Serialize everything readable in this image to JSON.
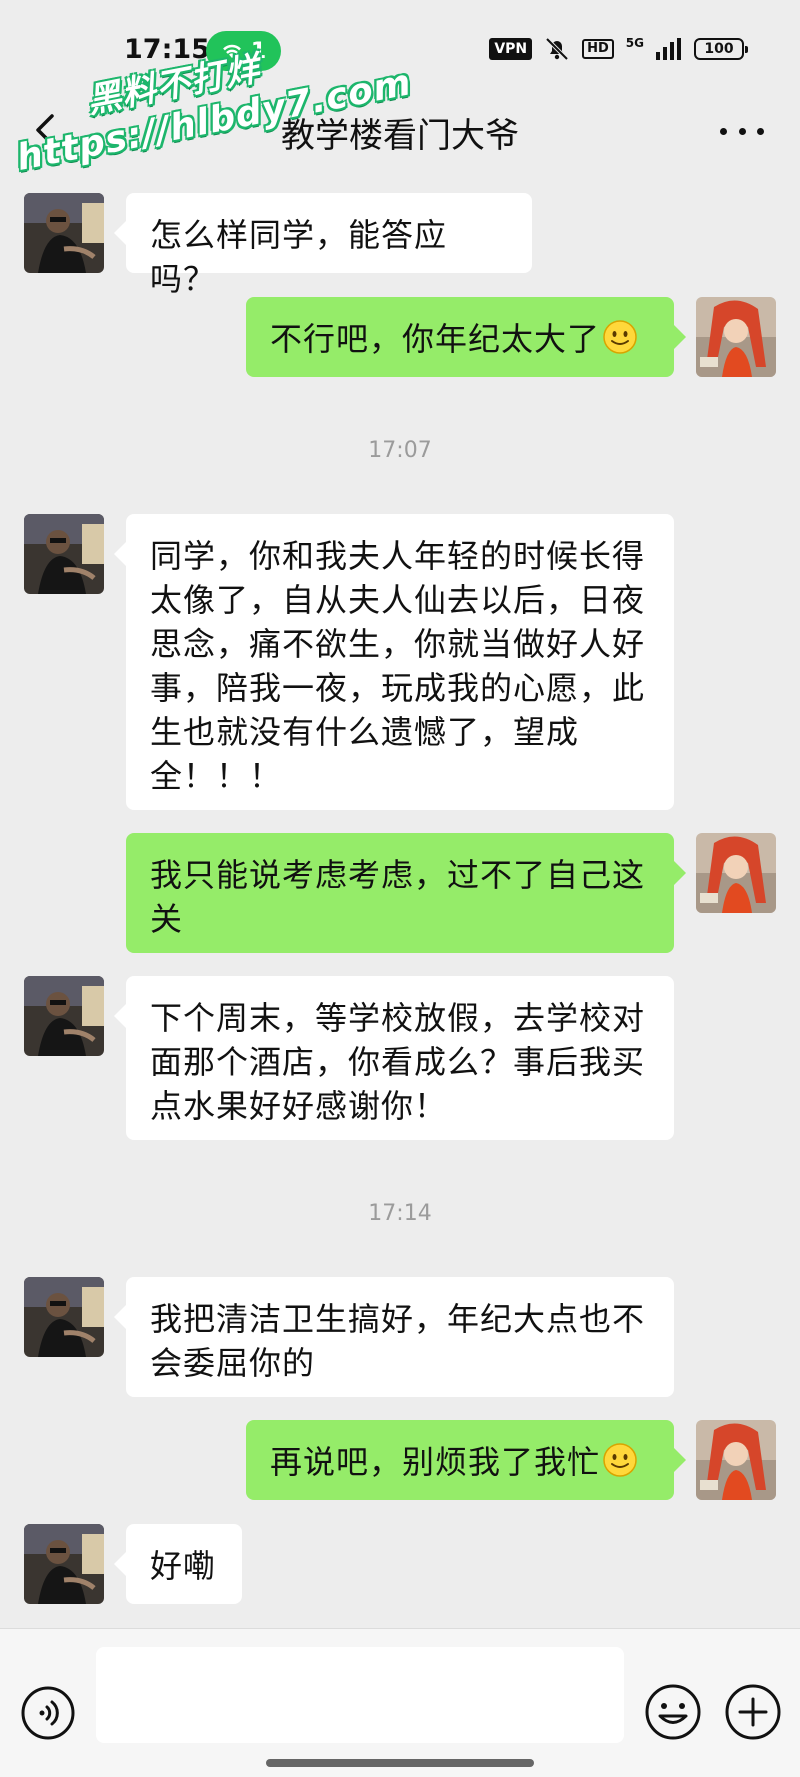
{
  "status_bar": {
    "time": "17:15",
    "wifi_count": "1",
    "vpn": "VPN",
    "hd": "HD",
    "network": "5G",
    "battery": "100"
  },
  "watermark": {
    "line1": "黑料不打烊",
    "line2": "https://hlbdy7.com"
  },
  "nav": {
    "title": "教学楼看门大爷"
  },
  "messages": [
    {
      "side": "in",
      "text": "怎么样同学，能答应吗？"
    },
    {
      "side": "out",
      "text": "不行吧，你年纪太大了"
    },
    {
      "side": "time",
      "text": "17:07"
    },
    {
      "side": "in",
      "text": "同学，你和我夫人年轻的时候长得太像了，自从夫人仙去以后，日夜思念，痛不欲生，你就当做好人好事，陪我一夜，玩成我的心愿，此生也就没有什么遗憾了，望成全！！！"
    },
    {
      "side": "out",
      "text": "我只能说考虑考虑，过不了自己这关"
    },
    {
      "side": "in",
      "text": "下个周末，等学校放假，去学校对面那个酒店，你看成么？事后我买点水果好好感谢你！"
    },
    {
      "side": "time",
      "text": "17:14"
    },
    {
      "side": "in",
      "text": "我把清洁卫生搞好，年纪大点也不会委屈你的"
    },
    {
      "side": "out",
      "text": "再说吧，别烦我了我忙"
    },
    {
      "side": "in",
      "text": "好嘞"
    }
  ],
  "input": {
    "value": "",
    "placeholder": ""
  },
  "colors": {
    "background": "#ededed",
    "incoming_bubble": "#ffffff",
    "outgoing_bubble": "#95ec69",
    "wifi_pill": "#21c35a",
    "watermark": "#1db66c"
  },
  "icons": {
    "back": "chevron-left-icon",
    "more": "more-dots-icon",
    "voice": "voice-icon",
    "emoji": "emoji-icon",
    "plus": "plus-icon",
    "smile": "smile-emoji-icon"
  }
}
